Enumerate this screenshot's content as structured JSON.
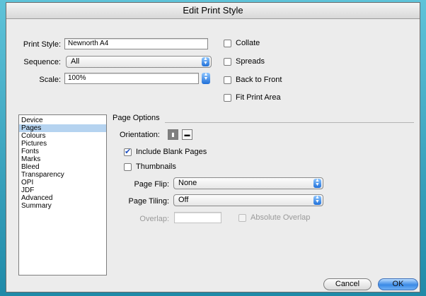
{
  "window": {
    "title": "Edit Print Style"
  },
  "form": {
    "print_style_label": "Print Style:",
    "print_style_value": "Newnorth A4",
    "sequence_label": "Sequence:",
    "sequence_value": "All",
    "scale_label": "Scale:",
    "scale_value": "100%"
  },
  "options": {
    "collate": "Collate",
    "spreads": "Spreads",
    "back_to_front": "Back to Front",
    "fit_print_area": "Fit Print Area"
  },
  "sidebar": {
    "items": [
      "Device",
      "Pages",
      "Colours",
      "Pictures",
      "Fonts",
      "Marks",
      "Bleed",
      "Transparency",
      "OPI",
      "JDF",
      "Advanced",
      "Summary"
    ],
    "selected": "Pages"
  },
  "page_options": {
    "group_title": "Page Options",
    "orientation_label": "Orientation:",
    "include_blank_pages": "Include Blank Pages",
    "include_blank_pages_checked": true,
    "thumbnails": "Thumbnails",
    "page_flip_label": "Page Flip:",
    "page_flip_value": "None",
    "page_tiling_label": "Page Tiling:",
    "page_tiling_value": "Off",
    "overlap_label": "Overlap:",
    "absolute_overlap": "Absolute Overlap"
  },
  "buttons": {
    "cancel": "Cancel",
    "ok": "OK"
  },
  "icons": {
    "popup_arrows": "updown-arrows-icon",
    "orientation_portrait": "portrait-icon",
    "orientation_landscape": "landscape-icon"
  }
}
